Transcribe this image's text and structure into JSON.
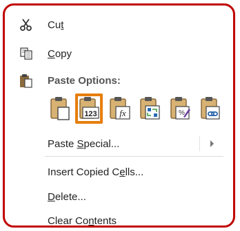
{
  "menu": {
    "cut": {
      "prefix": "Cu",
      "underline": "t",
      "suffix": ""
    },
    "copy": {
      "prefix": "",
      "underline": "C",
      "suffix": "opy"
    },
    "paste_options_heading": "Paste Options:",
    "paste_special": {
      "prefix": "Paste ",
      "underline": "S",
      "suffix": "pecial..."
    },
    "insert_copied_cells": {
      "prefix": "Insert Copied C",
      "underline": "e",
      "suffix": "lls..."
    },
    "delete": {
      "prefix": "",
      "underline": "D",
      "suffix": "elete..."
    },
    "clear_contents": {
      "prefix": "Clear Co",
      "underline": "n",
      "suffix": "tents"
    }
  },
  "paste_options": [
    {
      "name": "paste-icon"
    },
    {
      "name": "paste-values-icon",
      "badge": "123",
      "selected": true
    },
    {
      "name": "paste-formulas-icon",
      "badge": "fx"
    },
    {
      "name": "paste-transpose-icon"
    },
    {
      "name": "paste-formatting-icon"
    },
    {
      "name": "paste-link-icon"
    }
  ],
  "colors": {
    "frame_border": "#c00000",
    "selected_outline": "#e67e0c",
    "clipboard_brown": "#8b6b3d",
    "clipboard_tan": "#d7b273",
    "link_blue": "#1f5fa8"
  }
}
